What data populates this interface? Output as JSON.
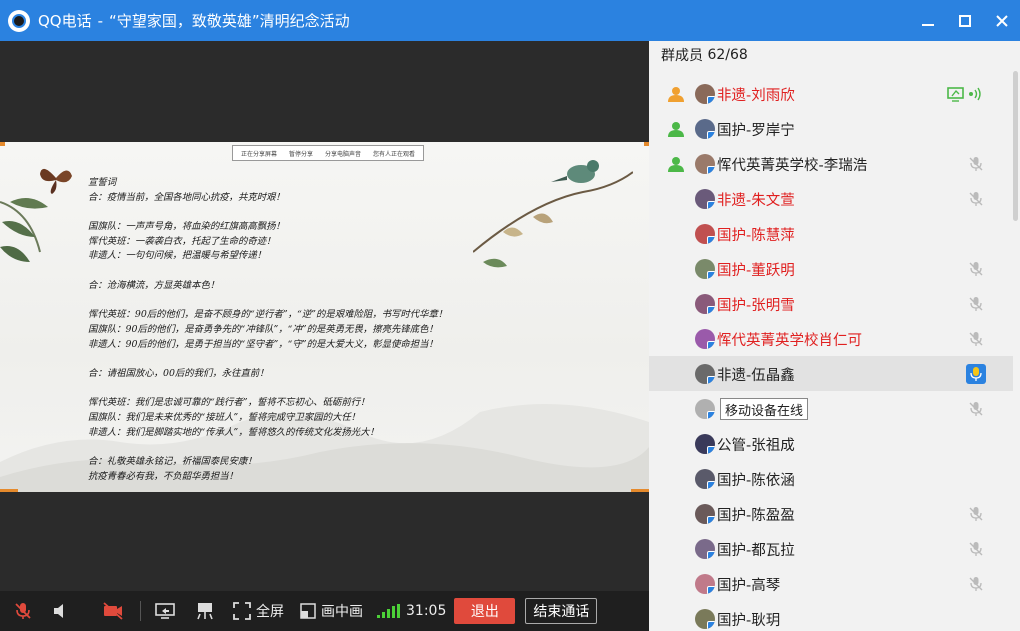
{
  "window": {
    "app_name": "QQ电话",
    "separator": "-",
    "meeting_title": "“守望家国，致敬英雄”清明纪念活动"
  },
  "slide": {
    "tabs": [
      "正在分享屏幕",
      "暂停分享",
      "分享电脑声音",
      "您有人正在观看"
    ],
    "lines": [
      "宣誓词",
      "合：疫情当前，全国各地同心抗疫，共克时艰！",
      "",
      "国旗队：一声声号角，将血染的红旗高高飘扬！",
      "恽代英班：一袭袭白衣，托起了生命的奇迹！",
      "非遗人：一句句问候，把温暖与希望传递！",
      "",
      "合：沧海横流，方显英雄本色！",
      "",
      "恽代英班：90后的他们，是奋不顾身的“逆行者”，“逆”的是艰难险阻，书写时代华章！",
      "国旗队：90后的他们，是奋勇争先的“冲锋队”，“冲”的是英勇无畏，擦亮先锋底色！",
      "非遗人：90后的他们，是勇于担当的“坚守者”，“守”的是大爱大义，彰显使命担当！",
      "",
      "合：请祖国放心，00后的我们，永往直前！",
      "",
      "恽代英班：我们是忠诚可靠的“践行者”，誓将不忘初心、砥砺前行！",
      "国旗队：我们是未来优秀的“接班人”，誓将完成守卫家园的大任！",
      "非遗人：我们是脚踏实地的“传承人”，誓将悠久的传统文化发扬光大！",
      "",
      "合：礼敬英雄永铭记，祈福国泰民安康！",
      "抗疫青春必有我，不负韶华勇担当！"
    ]
  },
  "toolbar": {
    "fullscreen_label": "全屏",
    "pip_label": "画中画",
    "timer": "31:05",
    "exit_label": "退出",
    "end_call_label": "结束通话"
  },
  "members": {
    "header_label": "群成员",
    "count": "62/68",
    "tooltip": "移动设备在线",
    "list": [
      {
        "name": "非遗-刘雨欣",
        "color": "red",
        "role": "host",
        "status": "sharing"
      },
      {
        "name": "国护-罗岸宁",
        "color": "dark",
        "role": "admin",
        "status": "none"
      },
      {
        "name": "恽代英菁英学校-李瑞浩",
        "color": "dark",
        "role": "admin",
        "status": "muted"
      },
      {
        "name": "非遗-朱文萱",
        "color": "red",
        "role": "none",
        "status": "muted"
      },
      {
        "name": "国护-陈慧萍",
        "color": "red",
        "role": "none",
        "status": "none"
      },
      {
        "name": "国护-董跃明",
        "color": "red",
        "role": "none",
        "status": "muted"
      },
      {
        "name": "国护-张明雪",
        "color": "red",
        "role": "none",
        "status": "muted"
      },
      {
        "name": "恽代英菁英学校肖仁可",
        "color": "red",
        "role": "none",
        "status": "muted"
      },
      {
        "name": "非遗-伍晶鑫",
        "color": "dark",
        "role": "none",
        "status": "speaking"
      },
      {
        "name": "",
        "color": "dark",
        "role": "none",
        "status": "muted"
      },
      {
        "name": "公管-张祖成",
        "color": "dark",
        "role": "none",
        "status": "none"
      },
      {
        "name": "国护-陈依涵",
        "color": "dark",
        "role": "none",
        "status": "none"
      },
      {
        "name": "国护-陈盈盈",
        "color": "dark",
        "role": "none",
        "status": "muted"
      },
      {
        "name": "国护-都瓦拉",
        "color": "dark",
        "role": "none",
        "status": "muted"
      },
      {
        "name": "国护-高琴",
        "color": "dark",
        "role": "none",
        "status": "muted"
      },
      {
        "name": "国护-耿玥",
        "color": "dark",
        "role": "none",
        "status": "none"
      }
    ]
  },
  "colors": {
    "titlebar": "#2b82e0",
    "exit_button": "#e04a3c",
    "signal": "#4cd038",
    "red_name": "#e02020",
    "share_icon": "#4cb848"
  }
}
